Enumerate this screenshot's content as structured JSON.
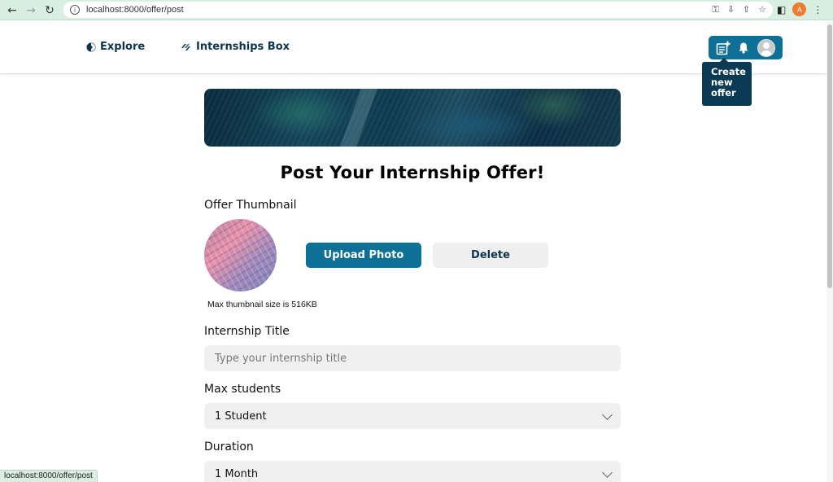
{
  "browser": {
    "url": "localhost:8000/offer/post",
    "profile_initial": "A",
    "status_url": "localhost:8000/offer/post"
  },
  "header": {
    "nav_explore": "Explore",
    "nav_brand": "Internships Box",
    "tooltip": "Create new offer"
  },
  "main": {
    "title": "Post Your Internship Offer!",
    "thumbnail_label": "Offer Thumbnail",
    "upload_button": "Upload Photo",
    "delete_button": "Delete",
    "thumbnail_hint": "Max thumbnail size is 516KB",
    "title_label": "Internship Title",
    "title_placeholder": "Type your internship title",
    "max_students_label": "Max students",
    "max_students_value": "1 Student",
    "duration_label": "Duration",
    "duration_value": "1 Month"
  },
  "colors": {
    "primary": "#0e6f97",
    "navy": "#0d3450",
    "input_bg": "#f0f0f0",
    "chrome_bg": "#d9efe1"
  }
}
